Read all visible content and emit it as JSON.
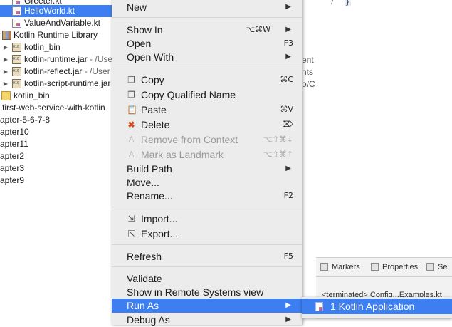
{
  "tree": {
    "items": [
      {
        "label": "Greeter.kt"
      },
      {
        "label": "HelloWorld.kt",
        "selected": true
      },
      {
        "label": "ValueAndVariable.kt"
      },
      {
        "label": "Kotlin Runtime Library"
      },
      {
        "label": "kotlin_bin"
      },
      {
        "label": "kotlin-runtime.jar",
        "suffix": " - /Use"
      },
      {
        "label": "kotlin-reflect.jar",
        "suffix": " - /User"
      },
      {
        "label": "kotlin-script-runtime.jar"
      },
      {
        "label": "kotlin_bin"
      },
      {
        "label": "first-web-service-with-kotlin"
      },
      {
        "label": "apter-5-6-7-8"
      },
      {
        "label": "apter10"
      },
      {
        "label": "apter11"
      },
      {
        "label": "apter2"
      },
      {
        "label": "apter3"
      },
      {
        "label": "apter9"
      }
    ]
  },
  "editor": {
    "line_number": "7",
    "code": "}",
    "peek_texts": [
      "ent",
      "nts",
      "o/C"
    ]
  },
  "views": {
    "tabs": [
      {
        "label": "Markers",
        "icon": "markers-icon"
      },
      {
        "label": "Properties",
        "icon": "properties-icon"
      },
      {
        "label": "Se",
        "icon": "servers-icon"
      }
    ],
    "console_text": "<terminated> Config...Examples.kt"
  },
  "menu": {
    "items": [
      {
        "label": "New",
        "submenu": true
      },
      {
        "label": "Show In",
        "shortcut": "⌥⌘W",
        "submenu": true
      },
      {
        "label": "Open",
        "shortcut": "F3"
      },
      {
        "label": "Open With",
        "submenu": true
      },
      {
        "label": "Copy",
        "shortcut": "⌘C",
        "icon": "copy-icon"
      },
      {
        "label": "Copy Qualified Name",
        "icon": "copy-qualified-name-icon"
      },
      {
        "label": "Paste",
        "shortcut": "⌘V",
        "icon": "paste-icon"
      },
      {
        "label": "Delete",
        "shortcut": "⌦",
        "icon": "delete-icon"
      },
      {
        "label": "Remove from Context",
        "shortcut": "⌥⇧⌘↓",
        "disabled": true,
        "icon": "remove-context-icon"
      },
      {
        "label": "Mark as Landmark",
        "shortcut": "⌥⇧⌘↑",
        "disabled": true,
        "icon": "landmark-icon"
      },
      {
        "label": "Build Path",
        "submenu": true
      },
      {
        "label": "Move..."
      },
      {
        "label": "Rename...",
        "shortcut": "F2"
      },
      {
        "label": "Import...",
        "icon": "import-icon"
      },
      {
        "label": "Export...",
        "icon": "export-icon"
      },
      {
        "label": "Refresh",
        "shortcut": "F5"
      },
      {
        "label": "Validate"
      },
      {
        "label": "Show in Remote Systems view"
      },
      {
        "label": "Run As",
        "submenu": true,
        "highlighted": true
      },
      {
        "label": "Debug As",
        "submenu": true
      }
    ]
  },
  "submenu": {
    "item_label": "1 Kotlin Application"
  },
  "colors": {
    "selection": "#3d7ff0",
    "menu_bg": "#ececec"
  }
}
